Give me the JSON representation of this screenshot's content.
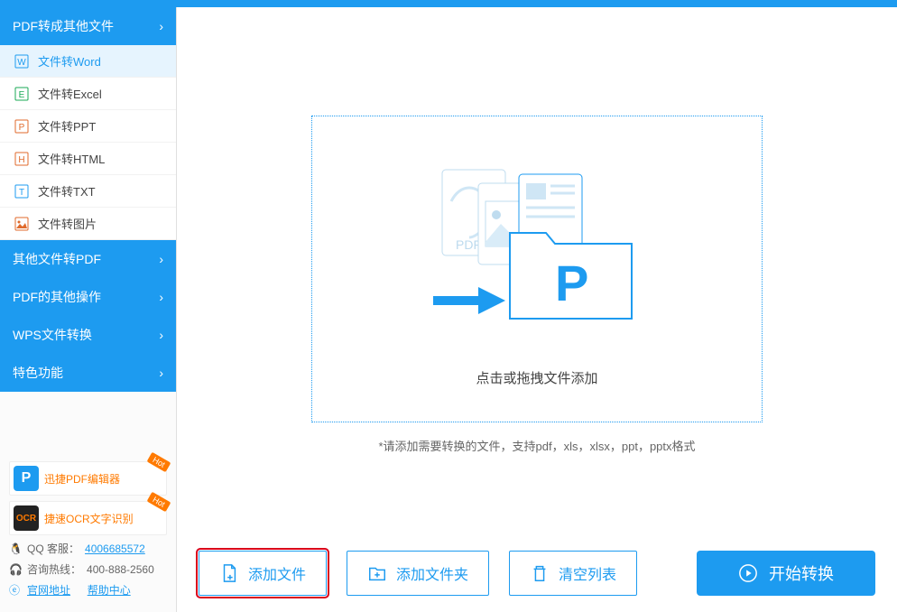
{
  "sidebar": {
    "categories": [
      {
        "label": "PDF转成其他文件",
        "expanded": true
      },
      {
        "label": "其他文件转PDF",
        "expanded": false
      },
      {
        "label": "PDF的其他操作",
        "expanded": false
      },
      {
        "label": "WPS文件转换",
        "expanded": false
      },
      {
        "label": "特色功能",
        "expanded": false
      }
    ],
    "pdf_to": [
      {
        "label": "文件转Word",
        "active": true,
        "icon_letter": "W",
        "icon_color": "#1d9bf0"
      },
      {
        "label": "文件转Excel",
        "active": false,
        "icon_letter": "E",
        "icon_color": "#1aaa55"
      },
      {
        "label": "文件转PPT",
        "active": false,
        "icon_letter": "P",
        "icon_color": "#e06a2b"
      },
      {
        "label": "文件转HTML",
        "active": false,
        "icon_letter": "H",
        "icon_color": "#e06a2b"
      },
      {
        "label": "文件转TXT",
        "active": false,
        "icon_letter": "T",
        "icon_color": "#1d9bf0"
      },
      {
        "label": "文件转图片",
        "active": false,
        "icon_letter": "▲",
        "icon_color": "#e06a2b"
      }
    ]
  },
  "promos": [
    {
      "text": "迅捷PDF编辑器",
      "badge": "Hot"
    },
    {
      "text": "捷速OCR文字识别",
      "badge": "Hot"
    }
  ],
  "support": {
    "qq_label": "QQ 客服：",
    "qq_value": "4006685572",
    "hotline_label": "咨询热线：",
    "hotline_value": "400-888-2560",
    "site_label": "官网地址",
    "help_label": "帮助中心"
  },
  "dropzone": {
    "text": "点击或拖拽文件添加",
    "hint": "*请添加需要转换的文件，支持pdf，xls，xlsx，ppt，pptx格式"
  },
  "actions": {
    "add_file": "添加文件",
    "add_folder": "添加文件夹",
    "clear_list": "清空列表",
    "start": "开始转换"
  }
}
